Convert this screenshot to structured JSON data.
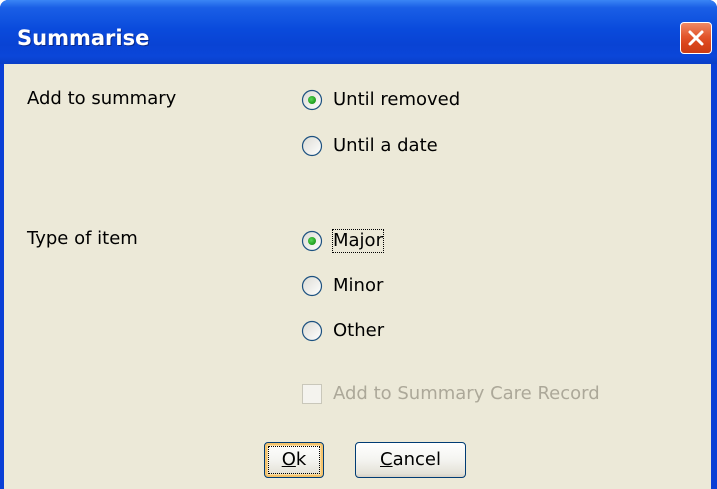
{
  "window": {
    "title": "Summarise"
  },
  "add_to_summary": {
    "label": "Add to summary",
    "options": [
      {
        "label": "Until removed",
        "selected": true
      },
      {
        "label": "Until a date",
        "selected": false
      }
    ]
  },
  "type_of_item": {
    "label": "Type of item",
    "options": [
      {
        "label": "Major",
        "selected": true
      },
      {
        "label": "Minor",
        "selected": false
      },
      {
        "label": "Other",
        "selected": false
      }
    ]
  },
  "scr_checkbox": {
    "label": "Add to Summary Care Record",
    "checked": false,
    "enabled": false
  },
  "buttons": {
    "ok_first": "O",
    "ok_rest": "k",
    "cancel_first": "C",
    "cancel_rest": "ancel"
  },
  "colors": {
    "titlebar": "#0a4bdc",
    "client_bg": "#ece9d8",
    "radio_dot": "#21a121",
    "disabled_text": "#aca899",
    "close_button": "#e2552c"
  }
}
